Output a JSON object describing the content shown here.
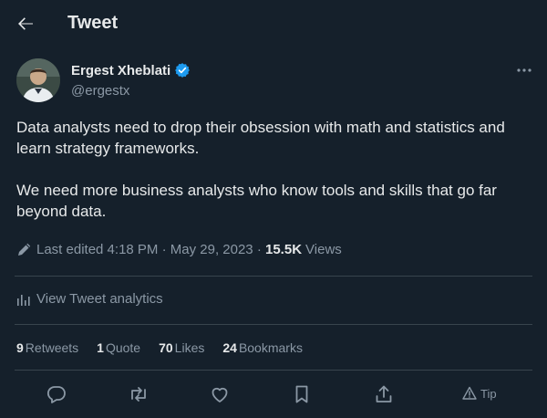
{
  "header": {
    "back_icon": "arrow-left-icon",
    "title": "Tweet"
  },
  "tweet": {
    "author": {
      "name": "Ergest Xheblati",
      "handle": "@ergestx",
      "verified_icon": "verified-badge-icon",
      "verified_color": "#1d9bf0"
    },
    "more_icon": "ellipsis-icon",
    "paragraphs": [
      "Data analysts need to drop their obsession with math and statistics and learn strategy frameworks.",
      "We need more business analysts who know tools and skills that go far beyond data."
    ],
    "meta": {
      "edit_icon": "pencil-icon",
      "edited": "Last edited 4:18 PM · May 29, 2023",
      "separator": " · ",
      "views_count": "15.5K",
      "views_label": "Views"
    },
    "analytics": {
      "icon": "bar-chart-icon",
      "label": "View Tweet analytics"
    },
    "stats": [
      {
        "count": "9",
        "label": "Retweets"
      },
      {
        "count": "1",
        "label": "Quote"
      },
      {
        "count": "70",
        "label": "Likes"
      },
      {
        "count": "24",
        "label": "Bookmarks"
      }
    ],
    "actions": {
      "reply_icon": "reply-icon",
      "retweet_icon": "retweet-icon",
      "like_icon": "heart-icon",
      "bookmark_icon": "bookmark-icon",
      "share_icon": "share-icon",
      "tip_icon": "tip-icon",
      "tip_label": "Tip"
    }
  },
  "colors": {
    "background": "#15202b",
    "text": "#e7e9ea",
    "muted": "#8b98a5",
    "divider": "#38444d",
    "accent": "#1d9bf0"
  }
}
